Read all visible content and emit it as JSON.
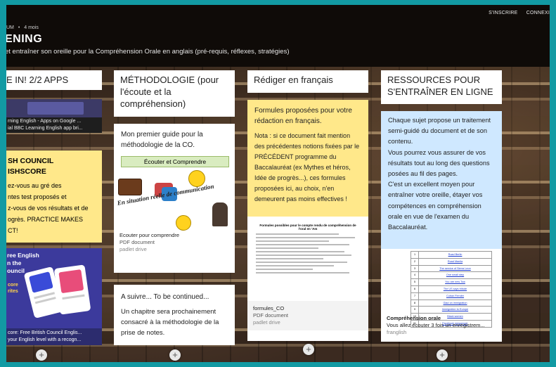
{
  "nav": {
    "signup": "S'INSCRIRE",
    "login": "CONNEXI"
  },
  "meta": {
    "author": "UM",
    "time": "4 mois"
  },
  "header": {
    "title": "ENING",
    "subtitle": "et entraîner son oreille pour la Compréhension Orale en anglais (pré-requis, réflexes, stratégies)"
  },
  "columns": [
    {
      "title": "E IN! 2/2 APPS",
      "link_card": {
        "line1": "rning English - Apps on Google ...",
        "line2": "ial BBC Learning English app bri..."
      },
      "note": {
        "heading": "SH COUNCIL\nISHSCORE",
        "body": "ez-vous au gré des\nntes test proposés et\nz-vous de vos résultats et de\nogrès. PRACTICE MAKES\nCT!"
      },
      "promo": {
        "headline": "ree English\nn the\nouncil",
        "badge": "core\nrites",
        "caption1": "core: Free British Council Englis...",
        "caption2": "your English level with a recogn..."
      }
    },
    {
      "title": "MÉTHODOLOGIE (pour l'écoute et la compréhension)",
      "card1": {
        "text": "Mon premier guide pour la méthodologie de la CO.",
        "banner": "Écouter et Comprendre",
        "curve": "En situation réelle de communication",
        "att_title": "Ecouter pour comprendre",
        "att_type": "PDF document",
        "att_src": "padlet drive"
      },
      "card2": {
        "heading": "A suivre... To be continued...",
        "body": "Un chapitre sera prochainement consacré à la méthodologie de la prise de notes."
      }
    },
    {
      "title": "Rédiger en français",
      "card": {
        "heading": "Formules proposées pour votre rédaction en français.",
        "body": "Nota : si ce document fait mention des précédentes notions fixées par le PRÉCÉDENT programme du Baccalauréat (ex Mythes et héros, Idée de progrès...), ces formules proposées ici, au choix, n'en demeurent pas moins effectives !",
        "doc_title": "Formules possibles pour le compte rendu de compréhension de l'oral en 'Am",
        "att_title": "formules_CO",
        "att_type": "PDF document",
        "att_src": "padlet drive"
      }
    },
    {
      "title": "RESSOURCES POUR S'ENTRAÎNER EN LIGNE",
      "card": {
        "body": "Chaque sujet propose un traitement semi-guidé du document et de son contenu.\nVous pourrez vous assurer de vos résultats tout au long des questions posées au fil des pages.\nC'est un excellent moyen pour entraîner votre oreille, étayer vos compétences en compréhension orale en vue de l'examen du Baccalauréat.",
        "list": [
          "Road Berlin",
          "Road Manila",
          "The service of Sierra Leon",
          "One small step",
          "You are new Tow",
          "The US says tribute",
          "Cuban Flender",
          "Glad on immigration",
          "Immigration to Europe",
          "Black women",
          "Facebook messenger"
        ],
        "att_title": "Compréhension orale",
        "att_desc": "Vous allez écouter 3 fois un enregistrem...",
        "att_src": "franglish"
      }
    }
  ],
  "add_label": "+",
  "colors": {
    "frame": "#129aa3",
    "yellow": "#ffe88a",
    "blue": "#cfe8ff",
    "purple": "#3c3a66"
  }
}
